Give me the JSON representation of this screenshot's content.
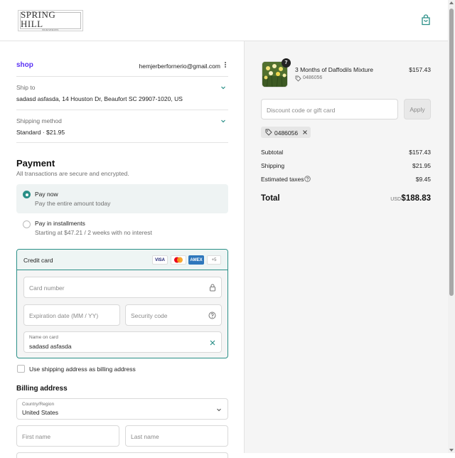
{
  "header": {
    "logo_title": "SPRING HILL",
    "logo_sub": "NURSERIES"
  },
  "contact": {
    "shop_label": "shop",
    "email": "hemjerberfornerio@gmail.com"
  },
  "ship_to": {
    "label": "Ship to",
    "value": "sadasd asfasda, 14 Houston Dr, Beaufort SC 29907-1020, US"
  },
  "shipping_method": {
    "label": "Shipping method",
    "value": "Standard · $21.95"
  },
  "payment": {
    "title": "Payment",
    "subtitle": "All transactions are secure and encrypted.",
    "options": [
      {
        "title": "Pay now",
        "sub": "Pay the entire amount today"
      },
      {
        "title": "Pay in installments",
        "sub": "Starting at $47.21 / 2 weeks with no interest"
      }
    ],
    "credit_card_label": "Credit card",
    "card_brands": [
      "VISA",
      "MC",
      "AMEX",
      "+5"
    ],
    "card_number_placeholder": "Card number",
    "expiration_placeholder": "Expiration date (MM / YY)",
    "security_placeholder": "Security code",
    "name_label": "Name on card",
    "name_value": "sadasd asfasda",
    "billing_checkbox_label": "Use shipping address as billing address"
  },
  "billing": {
    "title": "Billing address",
    "country_label": "Country/Region",
    "country_value": "United States",
    "first_name_placeholder": "First name",
    "last_name_placeholder": "Last name"
  },
  "summary": {
    "quantity": "7",
    "item_name": "3 Months of Daffodils Mixture",
    "item_code": "0486056",
    "item_price": "$157.43",
    "discount_placeholder": "Discount code or gift card",
    "apply_label": "Apply",
    "chip_code": "0486056",
    "subtotal_label": "Subtotal",
    "subtotal_value": "$157.43",
    "shipping_label": "Shipping",
    "shipping_value": "$21.95",
    "taxes_label": "Estimated taxes",
    "taxes_value": "$9.45",
    "total_label": "Total",
    "currency": "USD",
    "total_value": "$188.83"
  },
  "colors": {
    "accent": "#2a8f87",
    "shop_purple": "#5a31f4"
  },
  "icons": [
    "bag-icon",
    "chevron-down-icon",
    "kebab-icon",
    "lock-icon",
    "help-circle-icon",
    "clear-icon",
    "tag-icon",
    "info-icon"
  ]
}
